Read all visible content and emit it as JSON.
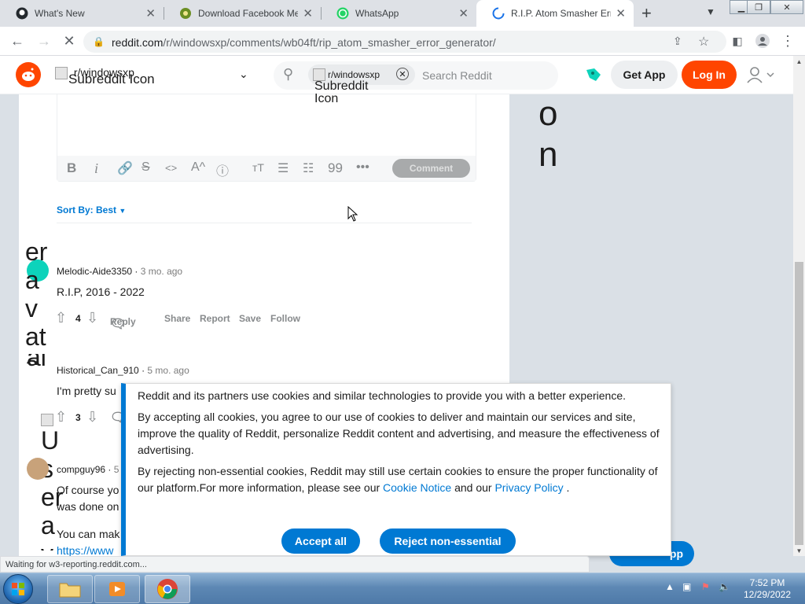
{
  "browser": {
    "tabs": [
      {
        "title": "What's New",
        "icon": "github-icon"
      },
      {
        "title": "Download Facebook Me",
        "icon": "downloader-icon"
      },
      {
        "title": "WhatsApp",
        "icon": "whatsapp-icon"
      },
      {
        "title": "R.I.P. Atom Smasher Erro",
        "icon": "loading-spinner-icon"
      }
    ],
    "url_domain": "reddit.com",
    "url_path": "/r/windowsxp/comments/wb04ft/rip_atom_smasher_error_generator/",
    "status": "Waiting for w3-reporting.reddit.com..."
  },
  "reddit": {
    "community_label": "r/windowsxp",
    "community_icon_alt": "Subreddit Icon",
    "search_chip": "r/windowsxp",
    "search_chip_alt": "Subreddit Icon",
    "search_placeholder": "Search Reddit",
    "get_app": "Get App",
    "login": "Log In",
    "sidebar_alt_text": "Ic o n"
  },
  "editor": {
    "comment_button": "Comment"
  },
  "sort": {
    "label": "Sort By: Best"
  },
  "comments": [
    {
      "author": "Melodic-Aide3350",
      "time": "3 mo. ago",
      "body": "R.I.P, 2016 - 2022",
      "votes": "4",
      "avatar_alt": "er a v at a",
      "avatar_color": "#0dd3bb"
    },
    {
      "author": "Historical_Can_910",
      "time": "5 mo. ago",
      "body": "I'm pretty su",
      "votes": "3",
      "avatar_alt": "U s er a v",
      "avatar_color": "#ffffff"
    },
    {
      "author": "compguy96",
      "time": "5",
      "body": "Of course yo",
      "body2": "was done on",
      "body3": "You can mak",
      "link": "https://www",
      "avatar_color": "#c8a27a"
    }
  ],
  "actions": {
    "reply": "Reply",
    "share": "Share",
    "report": "Report",
    "save": "Save",
    "follow": "Follow"
  },
  "cookie": {
    "p1": "Reddit and its partners use cookies and similar technologies to provide you with a better experience.",
    "p2": "By accepting all cookies, you agree to our use of cookies to deliver and maintain our services and site, improve the quality of Reddit, personalize Reddit content and advertising, and measure the effectiveness of advertising.",
    "p3_pre": "By rejecting non-essential cookies, Reddit may still use certain cookies to ensure the proper functionality of our platform.For more information, please see our ",
    "cookie_notice": "Cookie Notice",
    "p3_mid": " and our ",
    "privacy_policy": "Privacy Policy",
    "p3_end": " .",
    "accept": "Accept all",
    "reject": "Reject non-essential"
  },
  "bottom_pill": "pp",
  "taskbar": {
    "time": "7:52 PM",
    "date": "12/29/2022"
  }
}
